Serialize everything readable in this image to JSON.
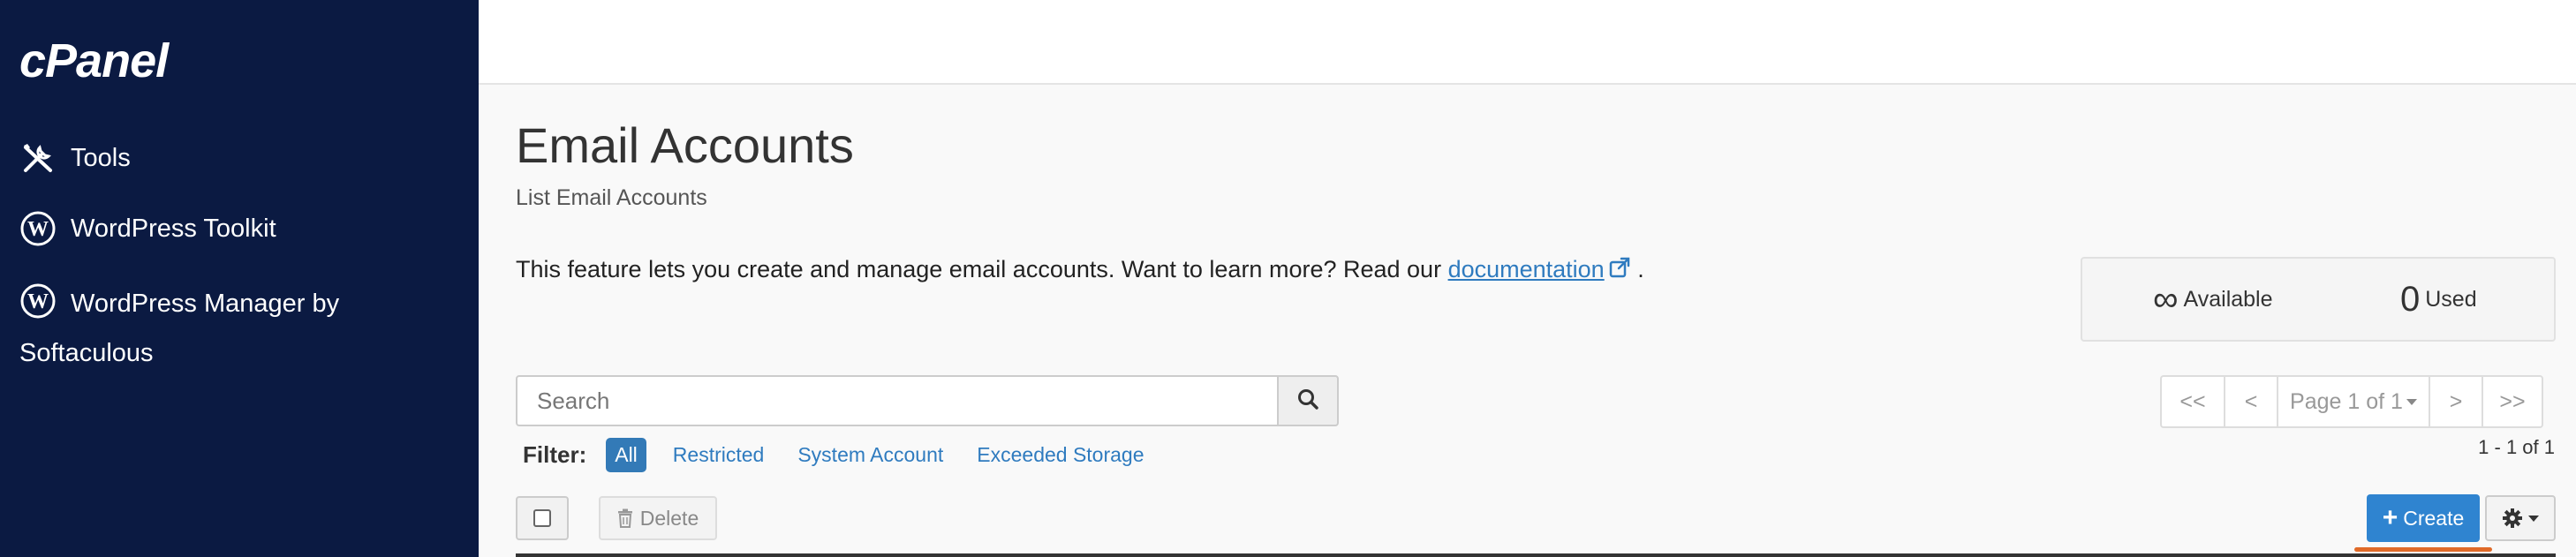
{
  "sidebar": {
    "logo": "cPanel",
    "items": [
      {
        "label": "Tools",
        "icon": "tools-icon"
      },
      {
        "label": "WordPress Toolkit",
        "icon": "wordpress-icon"
      },
      {
        "label": "WordPress Manager by Softaculous",
        "icon": "wordpress-icon"
      }
    ]
  },
  "main": {
    "title": "Email Accounts",
    "subtitle": "List Email Accounts",
    "intro_text": "This feature lets you create and manage email accounts. Want to learn more? Read our ",
    "intro_link": "documentation",
    "intro_end": ".",
    "stats": {
      "available_value": "∞",
      "available_label": "Available",
      "used_value": "0",
      "used_label": "Used"
    },
    "search": {
      "placeholder": "Search"
    },
    "filter": {
      "label": "Filter:",
      "options": [
        "All",
        "Restricted",
        "System Account",
        "Exceeded Storage"
      ],
      "active": "All"
    },
    "pager": {
      "first": "<<",
      "prev": "<",
      "page_label": "Page 1 of 1",
      "next": ">",
      "last": ">>"
    },
    "range": "1 - 1 of 1",
    "toolbar": {
      "delete_label": "Delete",
      "create_label": "Create"
    }
  },
  "colors": {
    "sidebar_bg": "#0b1a42",
    "link": "#2f7bbf",
    "primary": "#2f84d0",
    "highlight": "#e06a28"
  }
}
